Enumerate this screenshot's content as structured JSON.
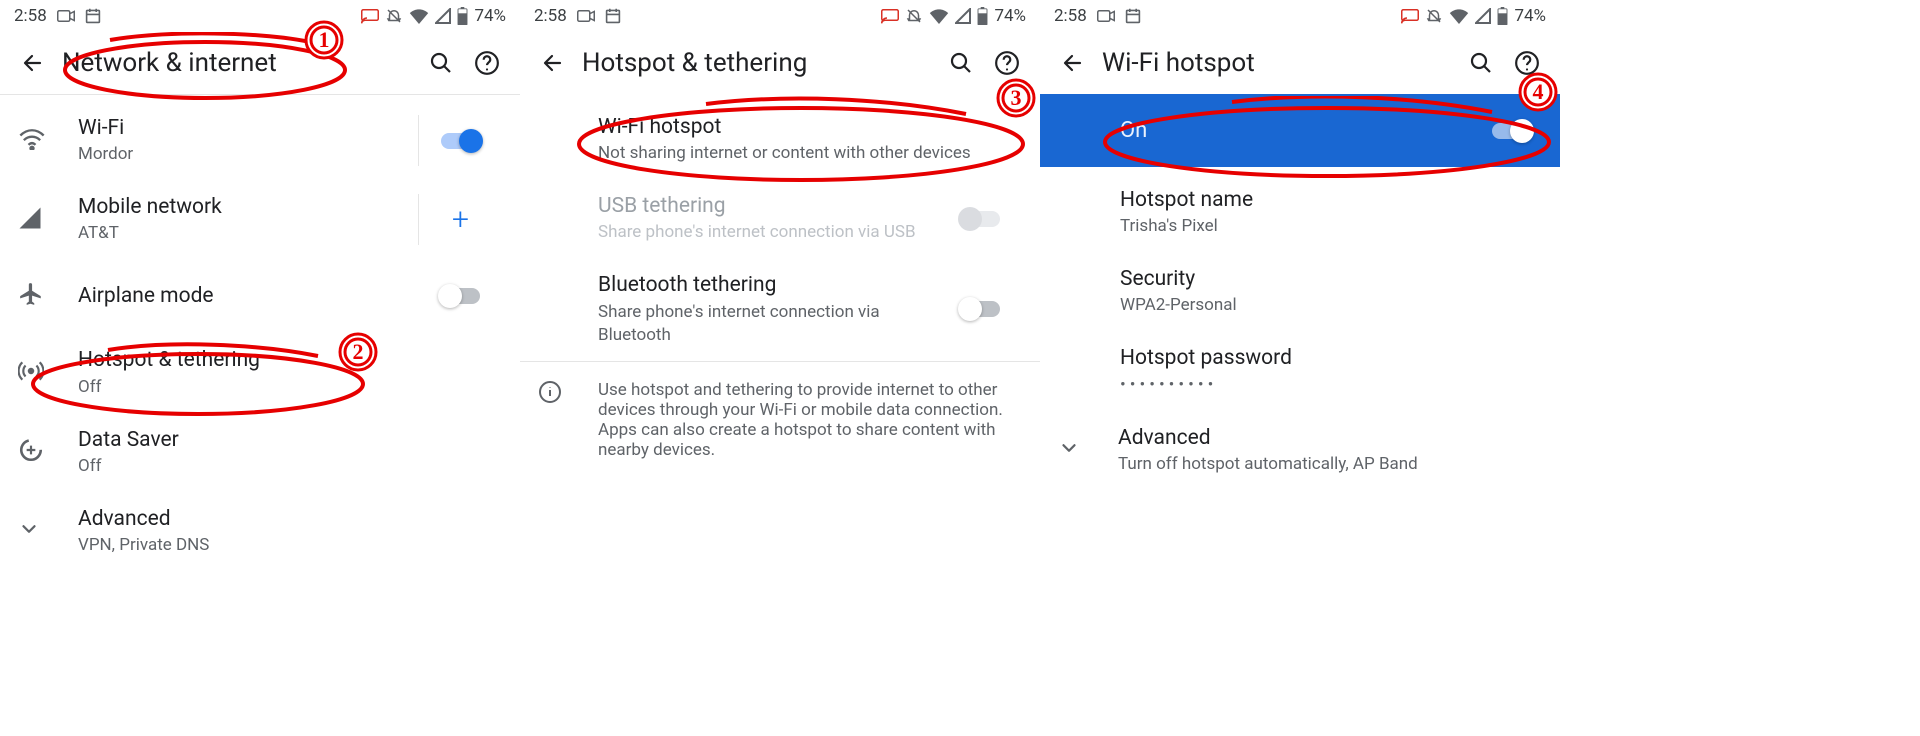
{
  "statusbar": {
    "time": "2:58",
    "battery": "74%"
  },
  "annotations": {
    "color": "#e60000",
    "steps": [
      "1",
      "2",
      "3",
      "4"
    ]
  },
  "screens": [
    {
      "title": "Network & internet",
      "items": {
        "wifi": {
          "label": "Wi-Fi",
          "sub": "Mordor"
        },
        "mobile": {
          "label": "Mobile network",
          "sub": "AT&T"
        },
        "airplane": {
          "label": "Airplane mode"
        },
        "hotspot": {
          "label": "Hotspot & tethering",
          "sub": "Off"
        },
        "datasaver": {
          "label": "Data Saver",
          "sub": "Off"
        },
        "advanced": {
          "label": "Advanced",
          "sub": "VPN, Private DNS"
        }
      },
      "state": {
        "wifi_on": true,
        "airplane_on": false
      }
    },
    {
      "title": "Hotspot & tethering",
      "items": {
        "wifi_hotspot": {
          "label": "Wi-Fi hotspot",
          "sub": "Not sharing internet or content with other devices"
        },
        "usb": {
          "label": "USB tethering",
          "sub": "Share phone's internet connection via USB"
        },
        "bt": {
          "label": "Bluetooth tethering",
          "sub": "Share phone's internet connection via Bluetooth"
        }
      },
      "footer": "Use hotspot and tethering to provide internet to other devices through your Wi-Fi or mobile data connection. Apps can also create a hotspot to share content with nearby devices."
    },
    {
      "title": "Wi-Fi hotspot",
      "banner": {
        "label": "On"
      },
      "items": {
        "name": {
          "label": "Hotspot name",
          "sub": "Trisha's Pixel"
        },
        "security": {
          "label": "Security",
          "sub": "WPA2-Personal"
        },
        "password": {
          "label": "Hotspot password",
          "sub": "••••••••••"
        },
        "advanced": {
          "label": "Advanced",
          "sub": "Turn off hotspot automatically, AP Band"
        }
      }
    }
  ]
}
